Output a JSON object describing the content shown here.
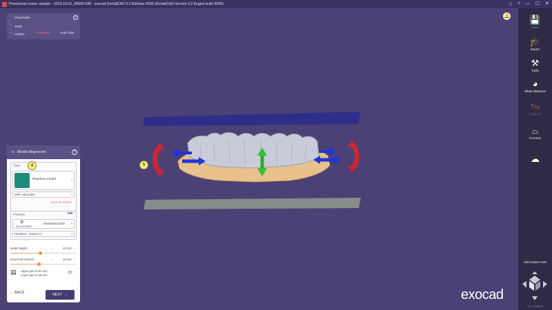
{
  "window": {
    "title": "Provisional crown, sample - 2023-10-01_99995-039 - exocad DentalCAD 3.2 Elefsina 9036 (DentalCAD-Version 3.2 Engine build 9036)",
    "controls": [
      "—",
      "☐",
      "✕"
    ],
    "toolbar_icons": [
      "user-icon",
      "help-icon"
    ]
  },
  "show_hide": {
    "title": "Show/Hide",
    "rows": [
      "Teeth",
      "Hidden"
    ],
    "show_all": "Show all",
    "auto_hide": "Auto hide"
  },
  "alignment": {
    "title": "Model Alignment",
    "type_label": "Type",
    "type_badge": "4",
    "model_type": "Plateless model",
    "dies_option": "With cutout dies",
    "save_default": "Save as default",
    "presets_label": "Presets",
    "printer": "NextDent 5100",
    "printer_logo": "3D SYSTEMS",
    "material": "NextDent - Model 2.0",
    "model_height_label": "Model height",
    "model_height_value": "40 mm",
    "model_height_fraction": 0.45,
    "drain_label": "Drain hole interval",
    "drain_value": "16 mm",
    "drain_fraction": 0.43,
    "upper_jaw": "Upper jaw 22.91 mm",
    "lower_jaw": "Lower jaw 23.39 mm",
    "back": "BACK",
    "next": "NEXT"
  },
  "viewport": {
    "step_badge": "5",
    "logo": "exocad"
  },
  "sidebar": {
    "items": [
      {
        "icon": "save-icon",
        "label": "Save",
        "enabled": false
      },
      {
        "icon": "expert-icon",
        "label": "Expert",
        "enabled": true
      },
      {
        "icon": "tools-icon",
        "label": "Tools",
        "enabled": true
      },
      {
        "icon": "show-distances-icon",
        "label": "Show distances",
        "enabled": true
      },
      {
        "icon": "truesmile-icon",
        "label": "Tru",
        "sublabel": "TruSmile",
        "enabled": false
      },
      {
        "icon": "cut-view-icon",
        "label": "Cut view",
        "enabled": true
      },
      {
        "icon": "cloud-icon",
        "label": "",
        "enabled": true
      }
    ],
    "add_custom_view": "Add custom view",
    "version": "v3.2-9036/64"
  },
  "colors": {
    "background": "#4c4175",
    "accent": "#ff7b55",
    "panel_header": "#5b5185",
    "sidebar": "#2f2a45"
  }
}
